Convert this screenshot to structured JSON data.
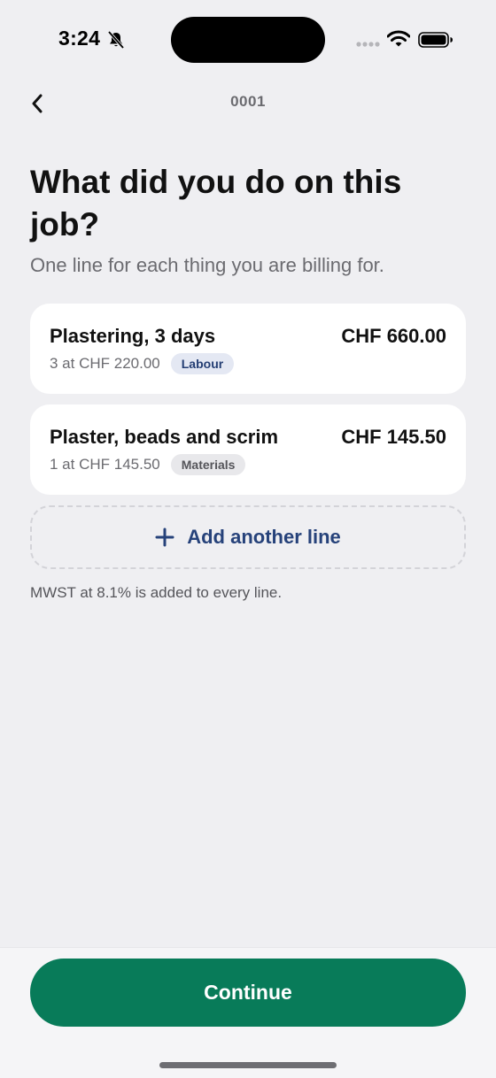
{
  "status_bar": {
    "time": "3:24",
    "icons": [
      "bell-slash-icon",
      "signal-icon",
      "wifi-icon",
      "battery-icon"
    ]
  },
  "nav": {
    "back_icon": "chevron-left-icon",
    "title": "0001"
  },
  "heading": {
    "title": "What did you do on this job?",
    "subtitle": "One line for each thing you are billing for."
  },
  "lines": [
    {
      "description": "Plastering, 3 days",
      "amount": "CHF 660.00",
      "quantity_text": "3 at CHF 220.00",
      "category": "Labour"
    },
    {
      "description": "Plaster, beads and scrim",
      "amount": "CHF 145.50",
      "quantity_text": "1 at CHF 145.50",
      "category": "Materials"
    }
  ],
  "add_line": {
    "icon": "plus-icon",
    "label": "Add another line"
  },
  "vat_note": "MWST at 8.1% is added to every line.",
  "footer": {
    "continue_label": "Continue"
  },
  "colors": {
    "background": "#efeff2",
    "accent": "#087b59",
    "link": "#26427a",
    "labour_badge_bg": "#e4e8f3",
    "materials_badge_bg": "#e8e8eb"
  }
}
